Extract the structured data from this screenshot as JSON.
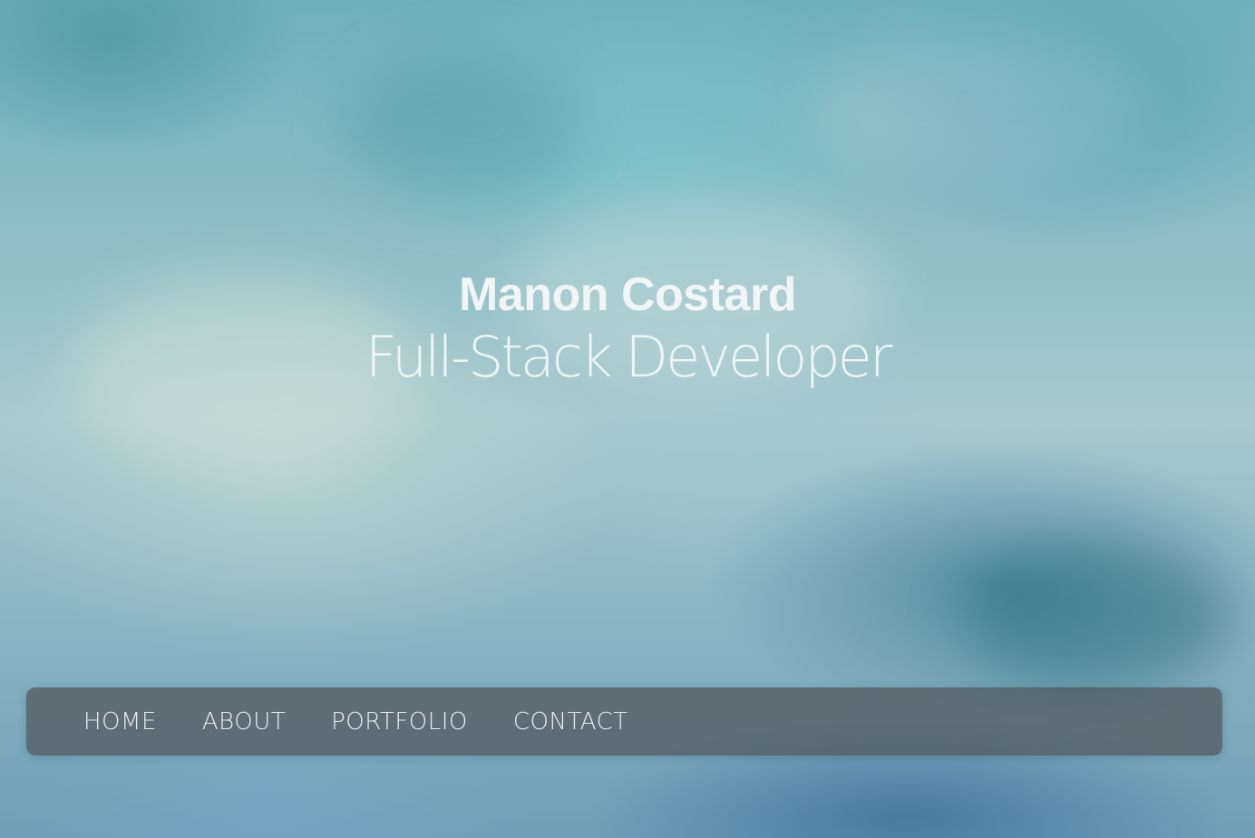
{
  "hero": {
    "name": "Manon Costard",
    "role": "Full-Stack Developer"
  },
  "nav": {
    "items": [
      {
        "label": "HOME"
      },
      {
        "label": "ABOUT"
      },
      {
        "label": "PORTFOLIO"
      },
      {
        "label": "CONTACT"
      }
    ]
  },
  "colors": {
    "text": "#f1f5f6",
    "navbar_bg": "#50565c",
    "background_teal": "#8fbfc6"
  }
}
